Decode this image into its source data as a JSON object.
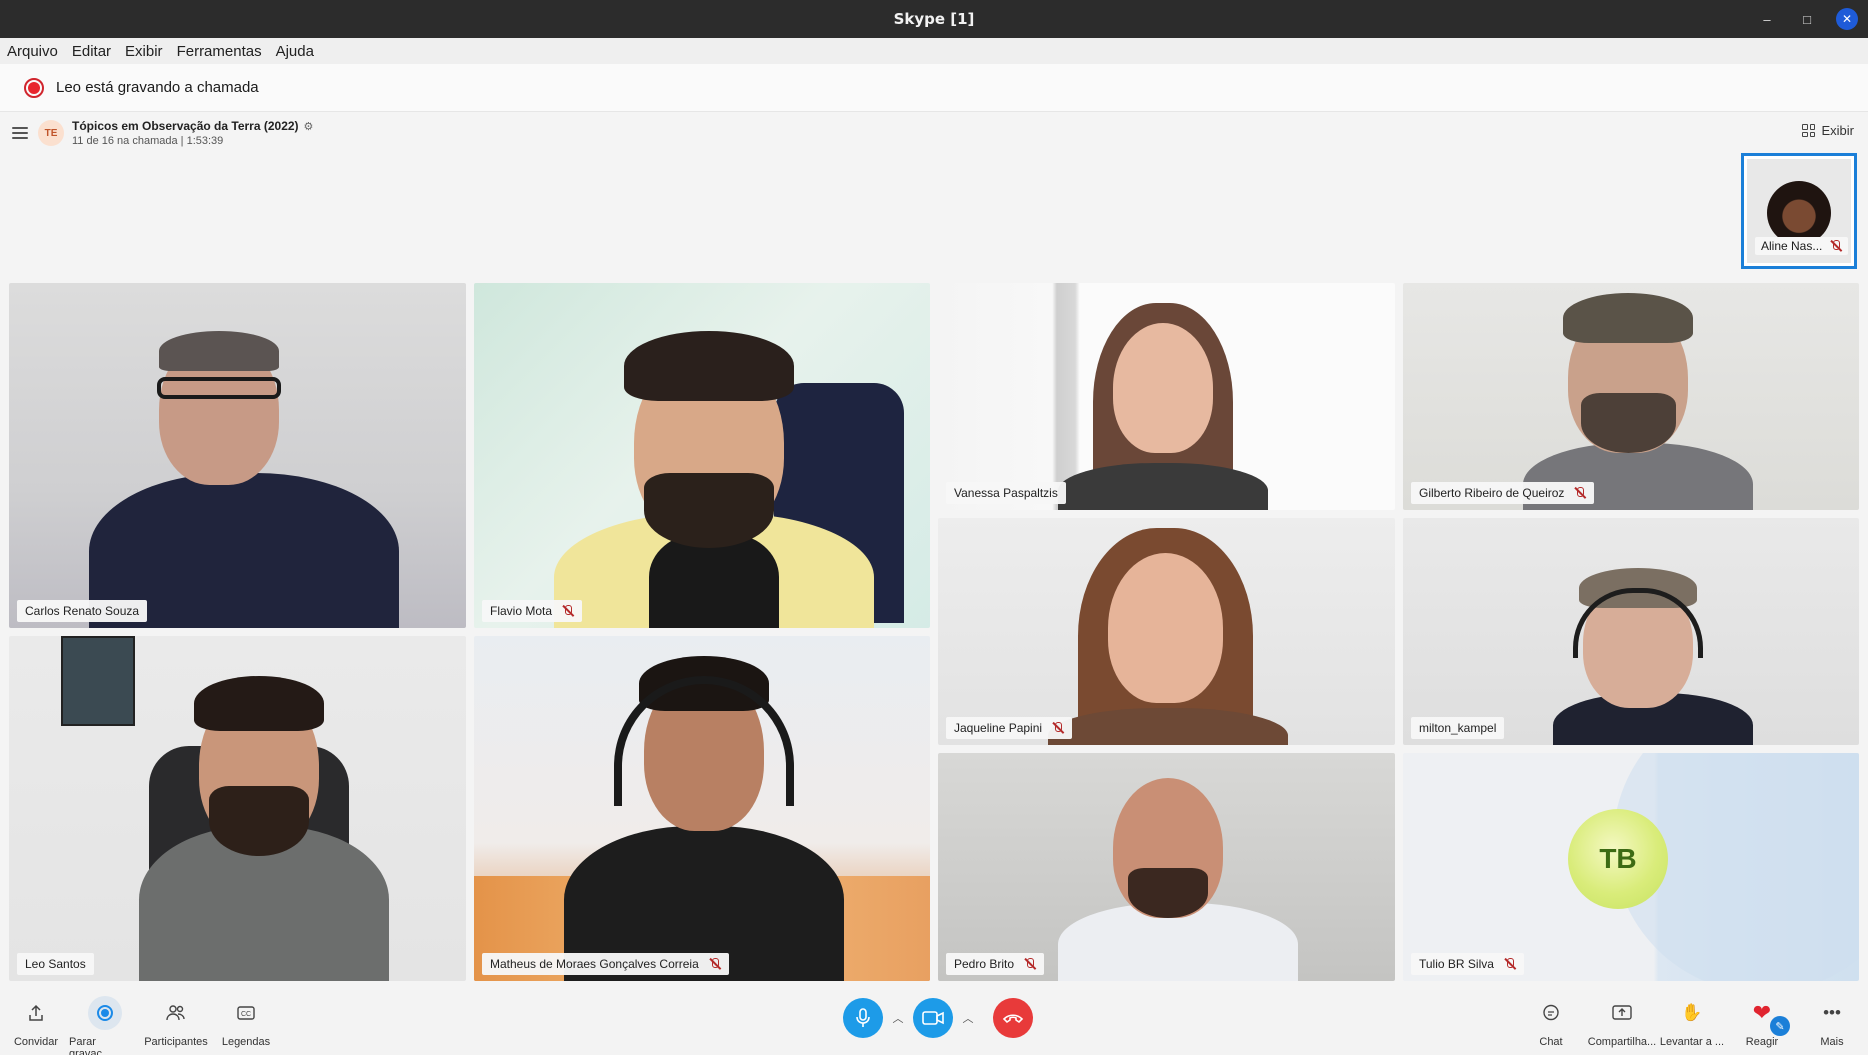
{
  "window": {
    "title": "Skype [1]",
    "minimize": "–",
    "maximize": "□",
    "close": "✕"
  },
  "menu": [
    "Arquivo",
    "Editar",
    "Exibir",
    "Ferramentas",
    "Ajuda"
  ],
  "recording_banner": "Leo está gravando a chamada",
  "conversation": {
    "avatar_initials": "TE",
    "title": "Tópicos em Observação da Terra (2022)",
    "subtitle": "11 de 16 na chamada | 1:53:39",
    "view_label": "Exibir"
  },
  "self_view": {
    "name": "Aline Nas...",
    "muted": true
  },
  "participants": [
    {
      "name": "Carlos Renato Souza",
      "muted": false
    },
    {
      "name": "Flavio Mota",
      "muted": true
    },
    {
      "name": "Vanessa Paspaltzis",
      "muted": false
    },
    {
      "name": "Gilberto Ribeiro de Queiroz",
      "muted": true
    },
    {
      "name": "Jaqueline Papini",
      "muted": true
    },
    {
      "name": "milton_kampel",
      "muted": false
    },
    {
      "name": "Leo Santos",
      "muted": false
    },
    {
      "name": "Matheus de Moraes Gonçalves Correia",
      "muted": true
    },
    {
      "name": "Pedro Brito",
      "muted": true
    },
    {
      "name": "Tulio BR Silva",
      "muted": true,
      "initials": "TB"
    }
  ],
  "toolbar": {
    "invite": "Convidar",
    "stop_recording": "Parar gravaç...",
    "participants": "Participantes",
    "captions": "Legendas",
    "chat": "Chat",
    "share": "Compartilha...",
    "raise_hand": "Levantar a ...",
    "react": "Reagir",
    "more": "Mais"
  },
  "colors": {
    "accent": "#1d9be8",
    "end_call": "#e83a3a",
    "record": "#e8262e",
    "selected_border": "#1b7fd8"
  }
}
